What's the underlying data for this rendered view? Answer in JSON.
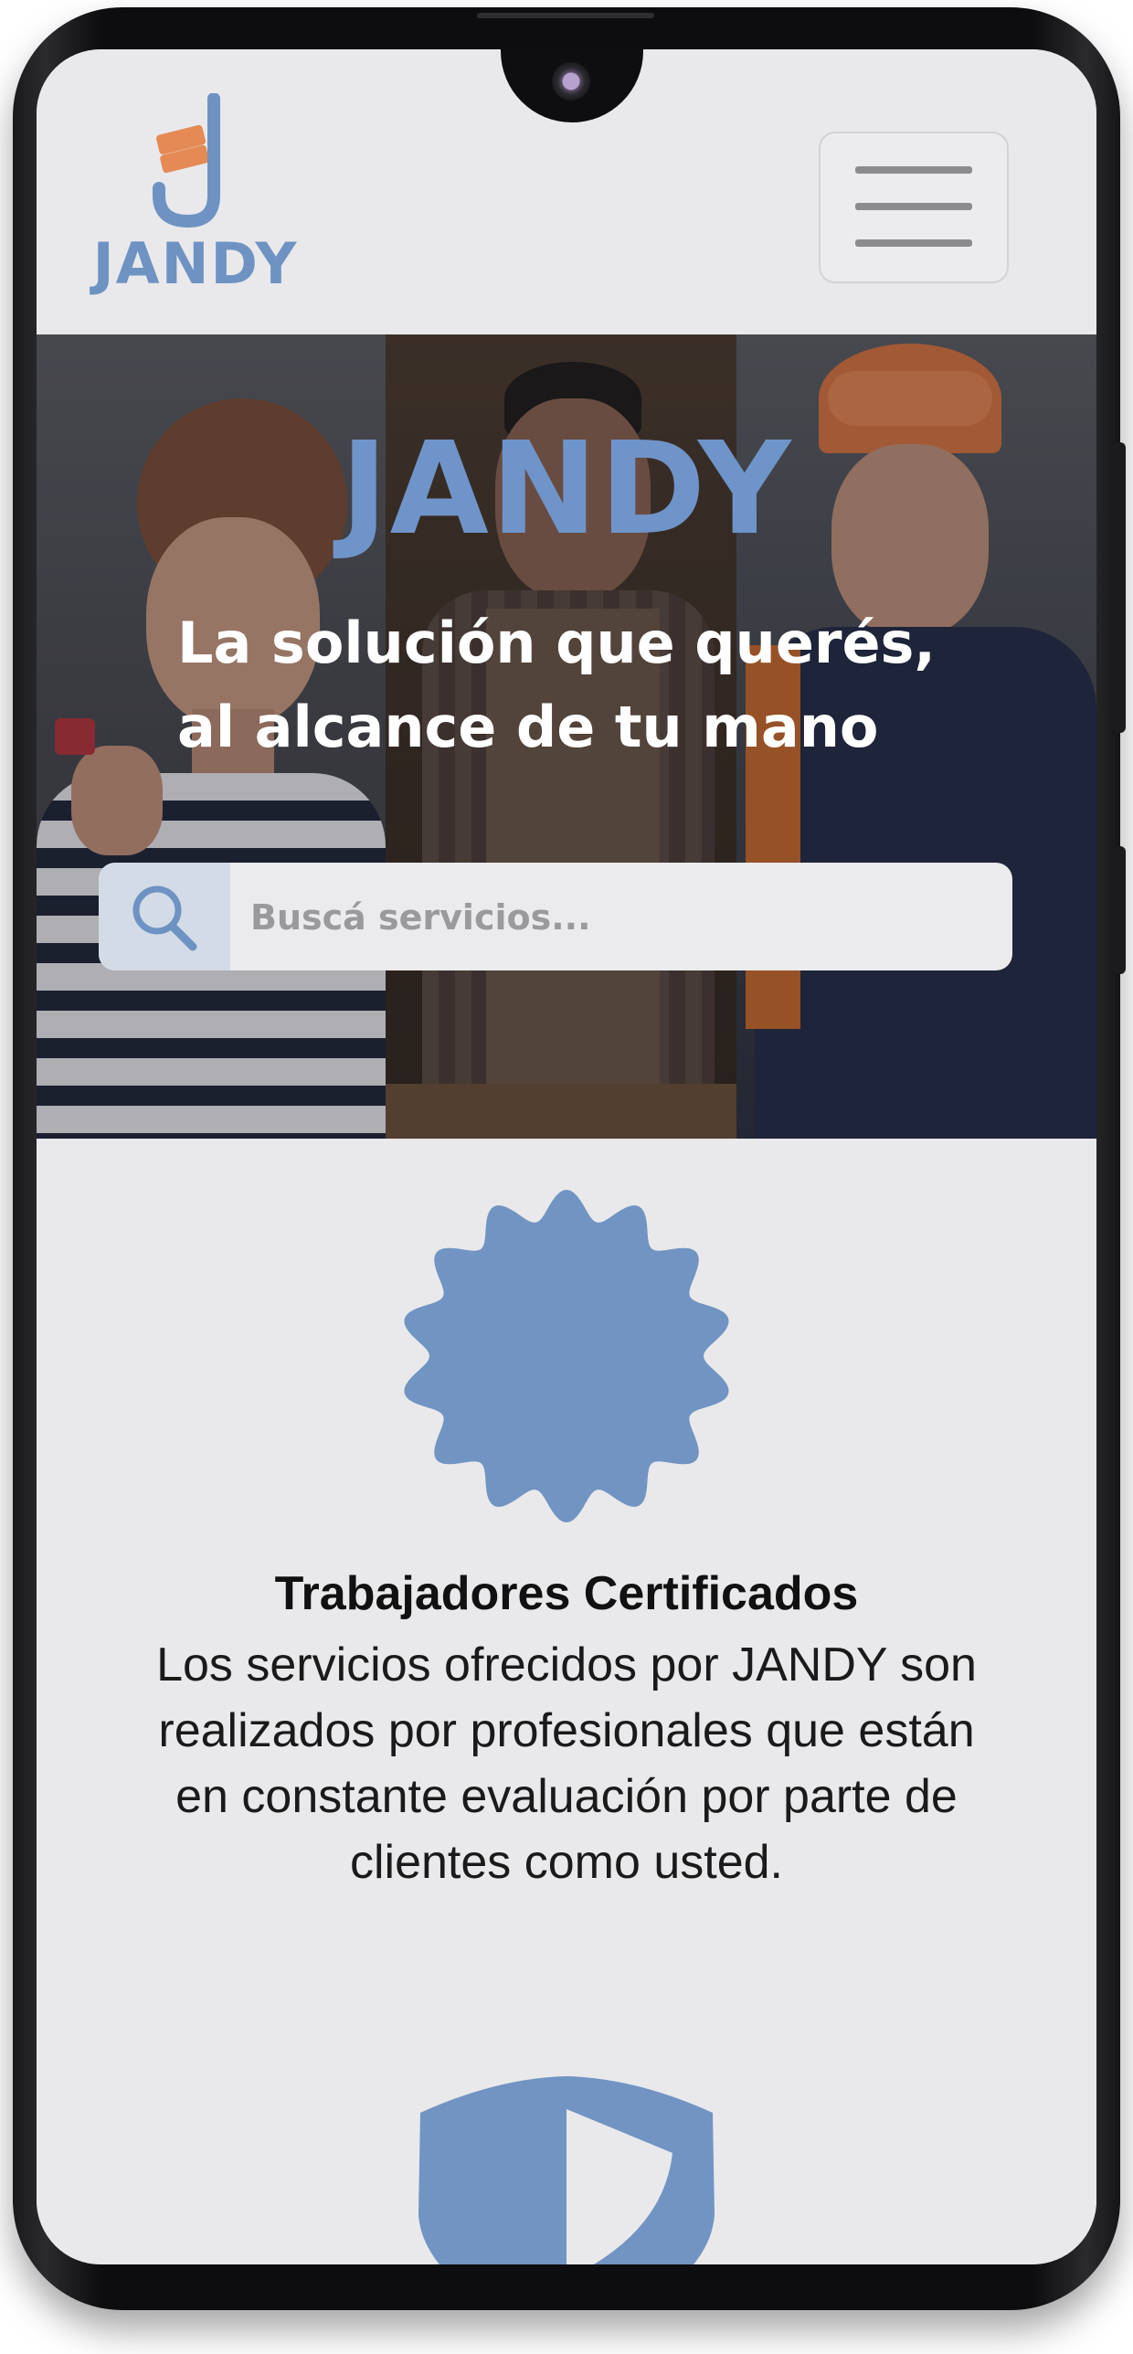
{
  "header": {
    "logo_text": "JANDY",
    "menu_button": "hamburger-menu-icon"
  },
  "hero": {
    "title": "JANDY",
    "tagline_line1": "La solución que querés,",
    "tagline_line2": "al alcance de tu mano",
    "search": {
      "placeholder": "Buscá servicios...",
      "icon": "search-icon"
    }
  },
  "features": {
    "items": [
      {
        "icon": "certified-badge-icon",
        "title": "Trabajadores Certificados",
        "line1": "Los servicios ofrecidos por JANDY son",
        "line2": "realizados por profesionales que están",
        "line3": "en constante evaluación por parte de",
        "line4": "clientes como usted."
      },
      {
        "icon": "shield-icon"
      }
    ]
  },
  "colors": {
    "brand_blue": "#6f94c9",
    "brand_orange": "#e58a55",
    "background": "#e9e9eb"
  }
}
